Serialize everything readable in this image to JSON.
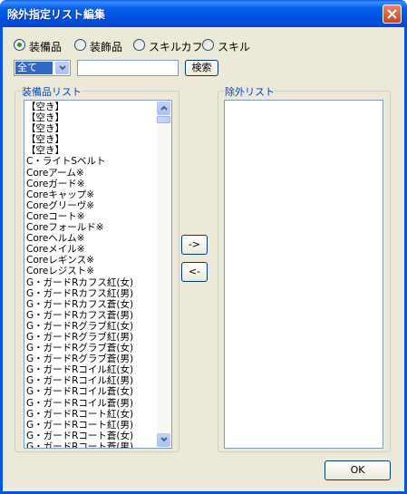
{
  "window": {
    "title": "除外指定リスト編集"
  },
  "category_radios": [
    {
      "label": "装備品",
      "selected": true
    },
    {
      "label": "装飾品",
      "selected": false
    },
    {
      "label": "スキルカフ",
      "selected": false
    },
    {
      "label": "スキル",
      "selected": false
    }
  ],
  "filter": {
    "combo_value": "全て",
    "search_value": "",
    "search_button": "検索"
  },
  "left_list": {
    "label": "装備品リスト",
    "items": [
      "【空き】",
      "【空き】",
      "【空き】",
      "【空き】",
      "【空き】",
      "C・ライトSベルト",
      "Coreアーム※",
      "Coreガード※",
      "Coreキャップ※",
      "Coreグリーヴ※",
      "Coreコート※",
      "Coreフォールド※",
      "Coreヘルム※",
      "Coreメイル※",
      "Coreレギンス※",
      "Coreレジスト※",
      "G・ガードRカフス紅(女)",
      "G・ガードRカフス紅(男)",
      "G・ガードRカフス蒼(女)",
      "G・ガードRカフス蒼(男)",
      "G・ガードRグラブ紅(女)",
      "G・ガードRグラブ紅(男)",
      "G・ガードRグラブ蒼(女)",
      "G・ガードRグラブ蒼(男)",
      "G・ガードRコイル紅(女)",
      "G・ガードRコイル紅(男)",
      "G・ガードRコイル蒼(女)",
      "G・ガードRコイル蒼(男)",
      "G・ガードRコート紅(女)",
      "G・ガードRコート紅(男)",
      "G・ガードRコート蒼(女)",
      "G・ガードRコート蒼(男)"
    ]
  },
  "right_list": {
    "label": "除外リスト",
    "items": []
  },
  "buttons": {
    "add": "->",
    "remove": "<-",
    "ok": "OK"
  },
  "colors": {
    "title_bar": "#0054e3",
    "dialog_bg": "#ece9d8",
    "group_label": "#0046d5",
    "selection": "#316ac5"
  }
}
